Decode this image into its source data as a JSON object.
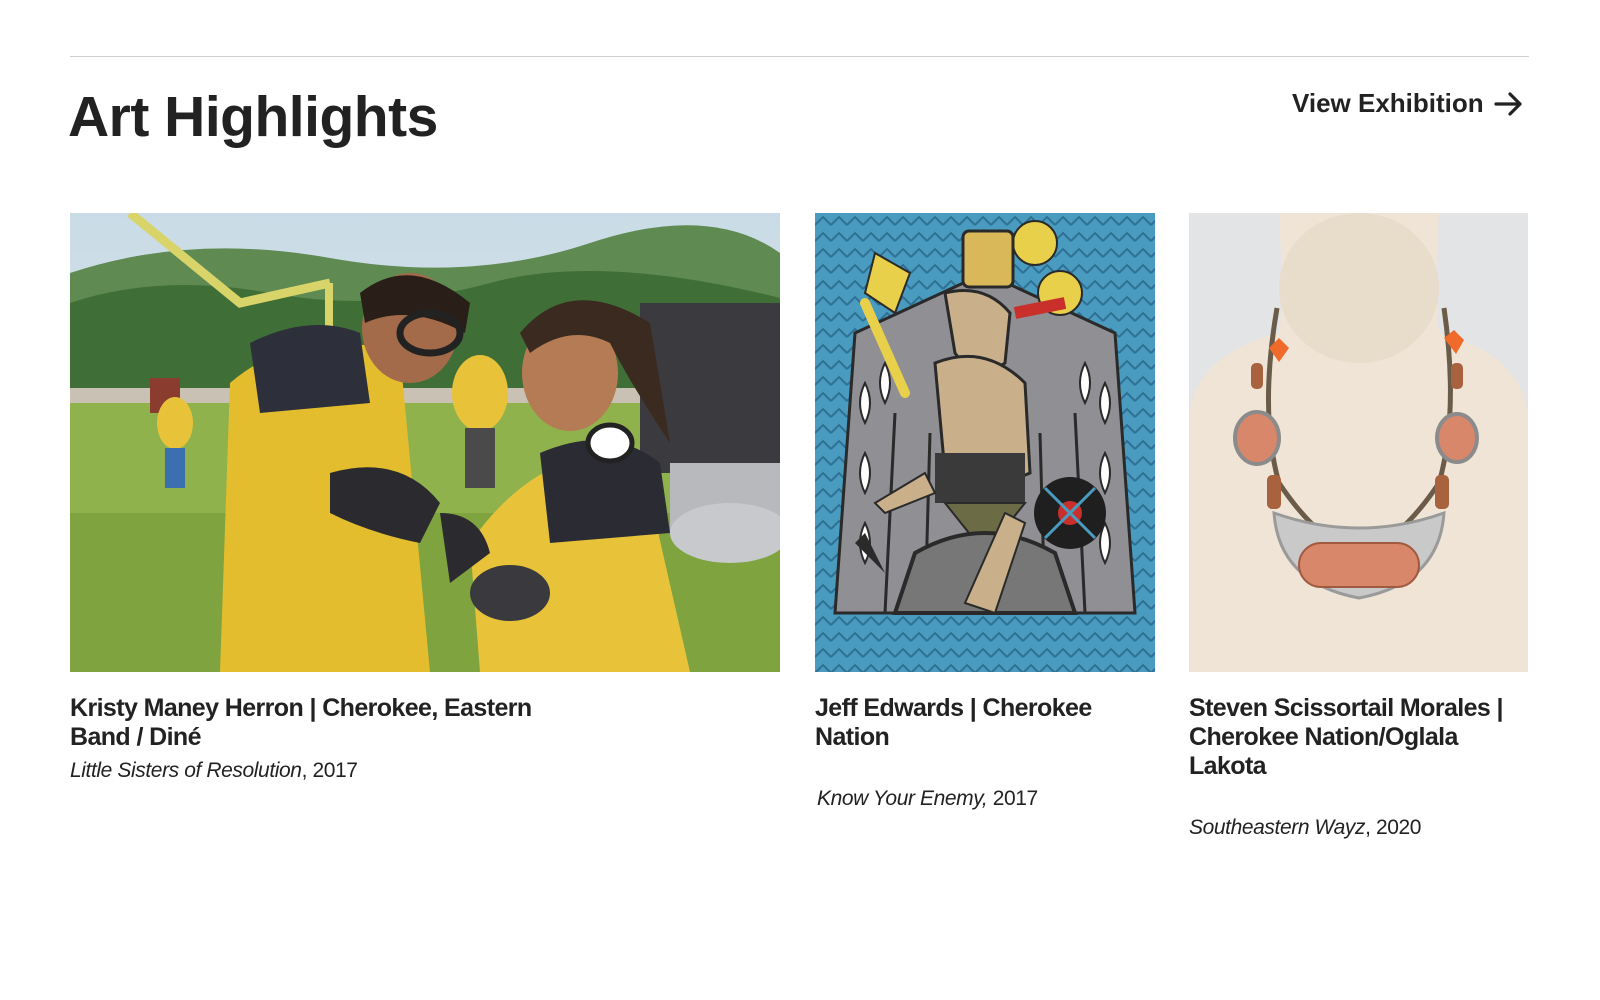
{
  "section": {
    "title": "Art Highlights",
    "link_label": "View Exhibition"
  },
  "icons": {
    "arrow": "arrow-right-icon"
  },
  "colors": {
    "text": "#222222",
    "rule": "#cfcfcf",
    "jersey_yellow": "#e8c33a",
    "painting_blue": "#4a9bc0",
    "mannequin": "#efe4d6",
    "copper": "#d9876b"
  },
  "cards": [
    {
      "artist": "Kristy Maney Herron | Cherokee, Eastern Band / Diné",
      "title": "Little Sisters of Resolution",
      "year": ", 2017"
    },
    {
      "artist": "Jeff Edwards | Cherokee Nation",
      "title": "Know Your Enemy,",
      "year": " 2017"
    },
    {
      "artist": "Steven Scissortail Morales | Cherokee Nation/Oglala Lakota",
      "title": "Southeastern Wayz",
      "year": ", 2020"
    }
  ]
}
